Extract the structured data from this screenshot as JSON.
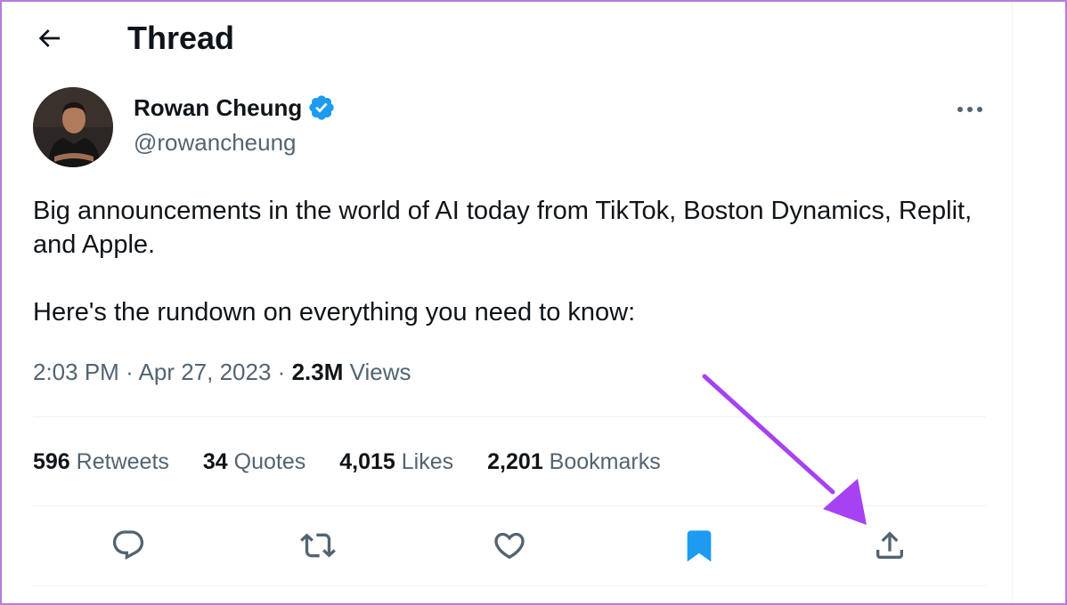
{
  "header": {
    "title": "Thread",
    "back_icon": "arrow-left-icon"
  },
  "author": {
    "name": "Rowan Cheung",
    "handle": "@rowancheung",
    "verified": true,
    "verified_color": "#1d9bf0"
  },
  "tweet": {
    "paragraphs": [
      "Big announcements in the world of AI today from TikTok, Boston Dynamics, Replit, and Apple.",
      "Here's the rundown on everything you need to know:"
    ],
    "time": "2:03 PM",
    "date": "Apr 27, 2023",
    "separator": "·",
    "views_count": "2.3M",
    "views_label": "Views"
  },
  "stats": [
    {
      "count": "596",
      "label": "Retweets"
    },
    {
      "count": "34",
      "label": "Quotes"
    },
    {
      "count": "4,015",
      "label": "Likes"
    },
    {
      "count": "2,201",
      "label": "Bookmarks"
    }
  ],
  "actions": [
    {
      "name": "reply",
      "icon": "speech-bubble-icon"
    },
    {
      "name": "retweet",
      "icon": "retweet-arrows-icon"
    },
    {
      "name": "like",
      "icon": "heart-outline-icon"
    },
    {
      "name": "bookmark",
      "icon": "bookmark-filled-icon",
      "active": true
    },
    {
      "name": "share",
      "icon": "share-upload-icon"
    }
  ],
  "colors": {
    "text_primary": "#0f1419",
    "text_secondary": "#536471",
    "accent_blue": "#1d9bf0",
    "annotation_arrow": "#a642f2",
    "divider": "#eff3f4"
  }
}
